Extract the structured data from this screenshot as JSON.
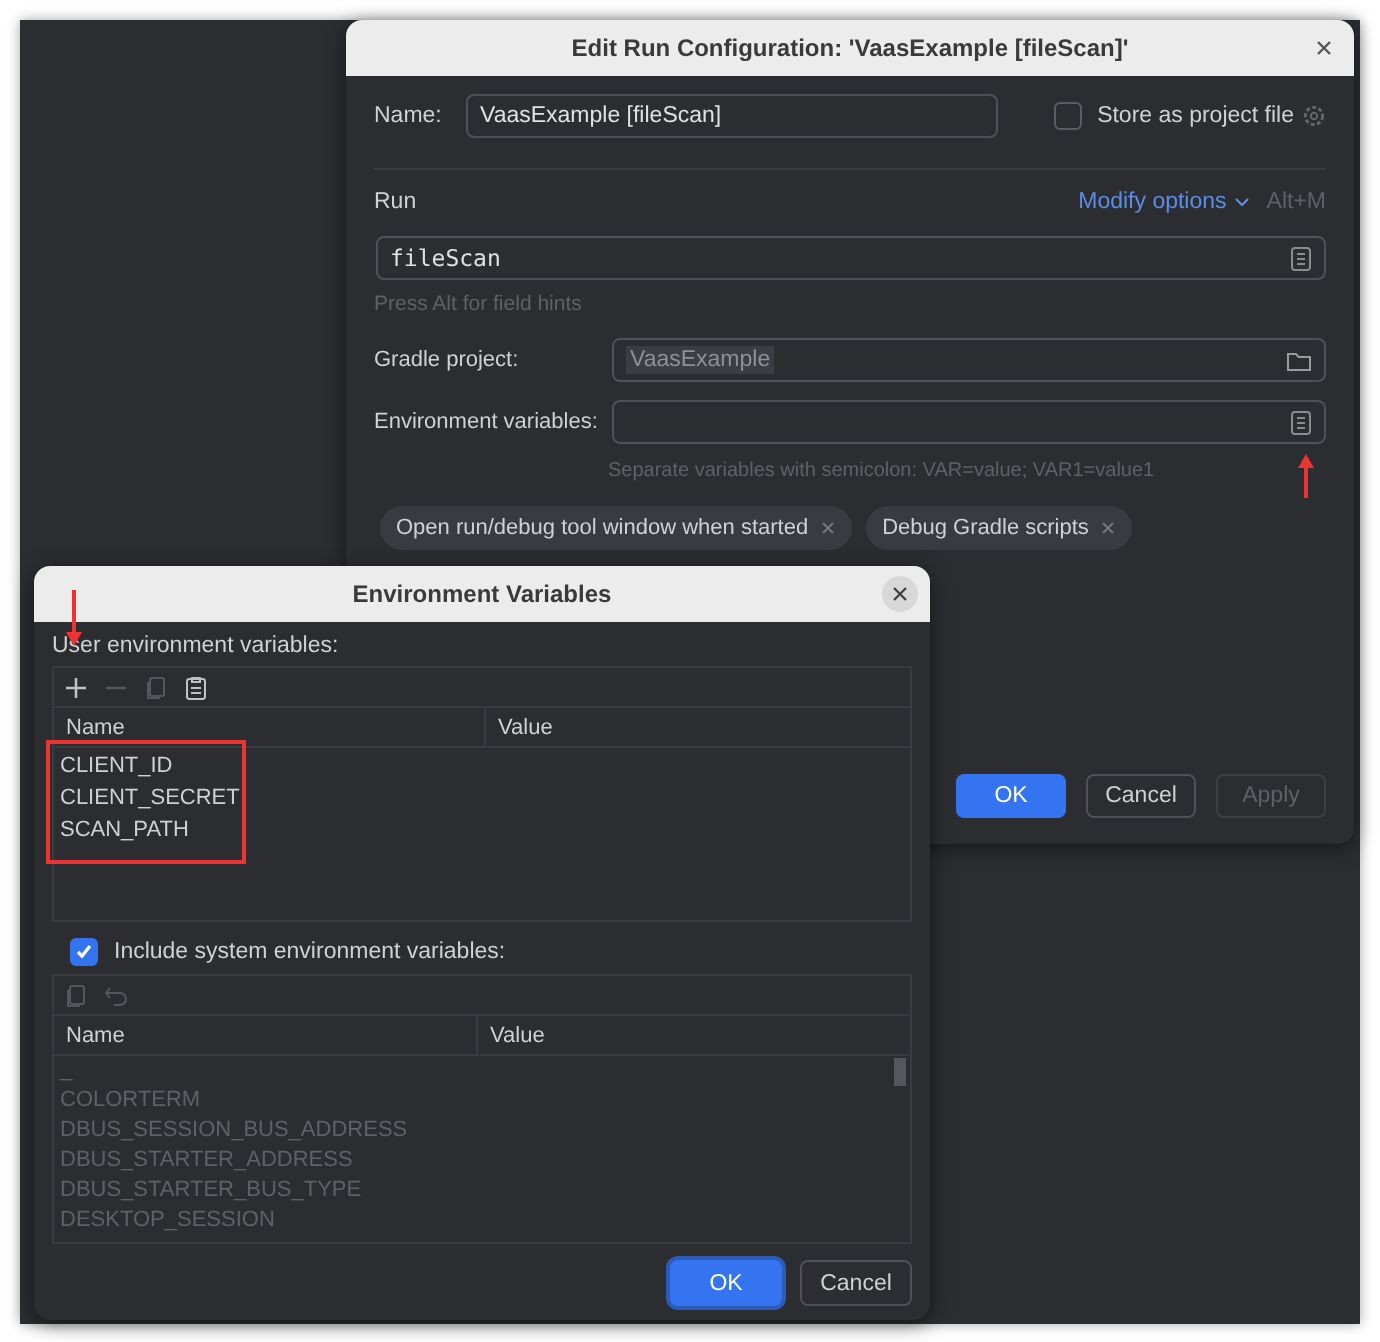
{
  "run_dialog": {
    "title": "Edit Run Configuration: 'VaasExample [fileScan]'",
    "name_label": "Name:",
    "name_value": "VaasExample [fileScan]",
    "store_checkbox": {
      "label": "Store as project file",
      "checked": false
    },
    "section": "Run",
    "modify_options": "Modify options",
    "shortcut": "Alt+M",
    "task_value": "fileScan",
    "hint": "Press Alt for field hints",
    "gradle_project": {
      "label": "Gradle project:",
      "value": "VaasExample"
    },
    "env_vars": {
      "label": "Environment variables:",
      "hint": "Separate variables with semicolon: VAR=value; VAR1=value1"
    },
    "chips": [
      {
        "label": "Open run/debug tool window when started"
      },
      {
        "label": "Debug Gradle scripts"
      }
    ],
    "buttons": [
      {
        "label": "OK",
        "kind": "primary"
      },
      {
        "label": "Cancel",
        "kind": "normal"
      },
      {
        "label": "Apply",
        "kind": "disabled"
      }
    ]
  },
  "env_dialog": {
    "title": "Environment Variables",
    "user_label": "User environment variables:",
    "user_toolbar": [
      {
        "kind": "add",
        "disabled": false
      },
      {
        "kind": "remove",
        "disabled": true
      },
      {
        "kind": "copy",
        "disabled": true
      },
      {
        "kind": "paste",
        "disabled": false
      }
    ],
    "user_table": {
      "columns": [
        "Name",
        "Value"
      ],
      "rows": [
        {
          "name": "CLIENT_ID"
        },
        {
          "name": "CLIENT_SECRET"
        },
        {
          "name": "SCAN_PATH"
        }
      ]
    },
    "include_system": {
      "label": "Include system environment variables:",
      "checked": true
    },
    "system_toolbar": [
      {
        "kind": "copy",
        "disabled": true
      },
      {
        "kind": "undo",
        "disabled": true
      }
    ],
    "system_table": {
      "columns": [
        "Name",
        "Value"
      ],
      "rows": [
        {
          "name": "_"
        },
        {
          "name": "COLORTERM"
        },
        {
          "name": "DBUS_SESSION_BUS_ADDRESS"
        },
        {
          "name": "DBUS_STARTER_ADDRESS"
        },
        {
          "name": "DBUS_STARTER_BUS_TYPE"
        },
        {
          "name": "DESKTOP_SESSION"
        }
      ]
    },
    "buttons": [
      {
        "label": "OK",
        "kind": "primary"
      },
      {
        "label": "Cancel",
        "kind": "normal"
      }
    ]
  }
}
